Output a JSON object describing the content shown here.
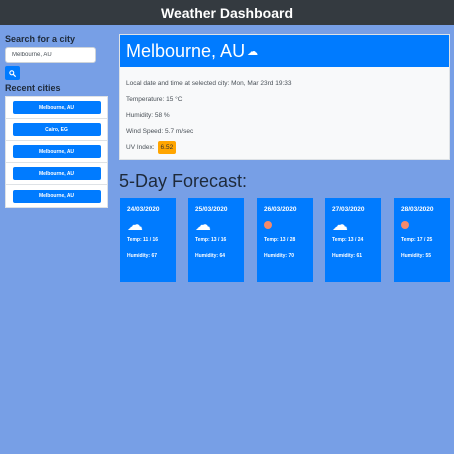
{
  "header": {
    "title": "Weather Dashboard"
  },
  "search": {
    "label": "Search for a city",
    "value": "Melbourne, AU"
  },
  "recent": {
    "label": "Recent cities",
    "items": [
      "Melbourne, AU",
      "Cairo, EG",
      "Melbourne, AU",
      "Melbourne, AU",
      "Melbourne, AU"
    ]
  },
  "current": {
    "city": "Melbourne, AU",
    "icon": "cloud-icon",
    "datetime": "Local date and time at selected city: Mon, Mar 23rd 19:33",
    "temperature": "Temperature: 15 °C",
    "humidity": "Humidity: 58 %",
    "wind": "Wind Speed: 5.7 m/sec",
    "uv_label": "UV Index:",
    "uv_value": "6.52"
  },
  "forecast": {
    "title": "5-Day Forecast:",
    "days": [
      {
        "date": "24/03/2020",
        "icon": "cloud-icon",
        "temp": "Temp: 11 / 16",
        "humidity": "Humidity: 67"
      },
      {
        "date": "25/03/2020",
        "icon": "cloud-icon",
        "temp": "Temp: 13 / 16",
        "humidity": "Humidity: 64"
      },
      {
        "date": "26/03/2020",
        "icon": "sun-icon",
        "temp": "Temp: 13 / 28",
        "humidity": "Humidity: 70"
      },
      {
        "date": "27/03/2020",
        "icon": "cloud-icon",
        "temp": "Temp: 13 / 24",
        "humidity": "Humidity: 61"
      },
      {
        "date": "28/03/2020",
        "icon": "sun-icon",
        "temp": "Temp: 17 / 25",
        "humidity": "Humidity: 55"
      }
    ]
  },
  "colors": {
    "background": "#779fe6",
    "primary": "#007bff",
    "header": "#343a40",
    "uv_badge": "#ffa500",
    "sun": "#f58a6b"
  }
}
